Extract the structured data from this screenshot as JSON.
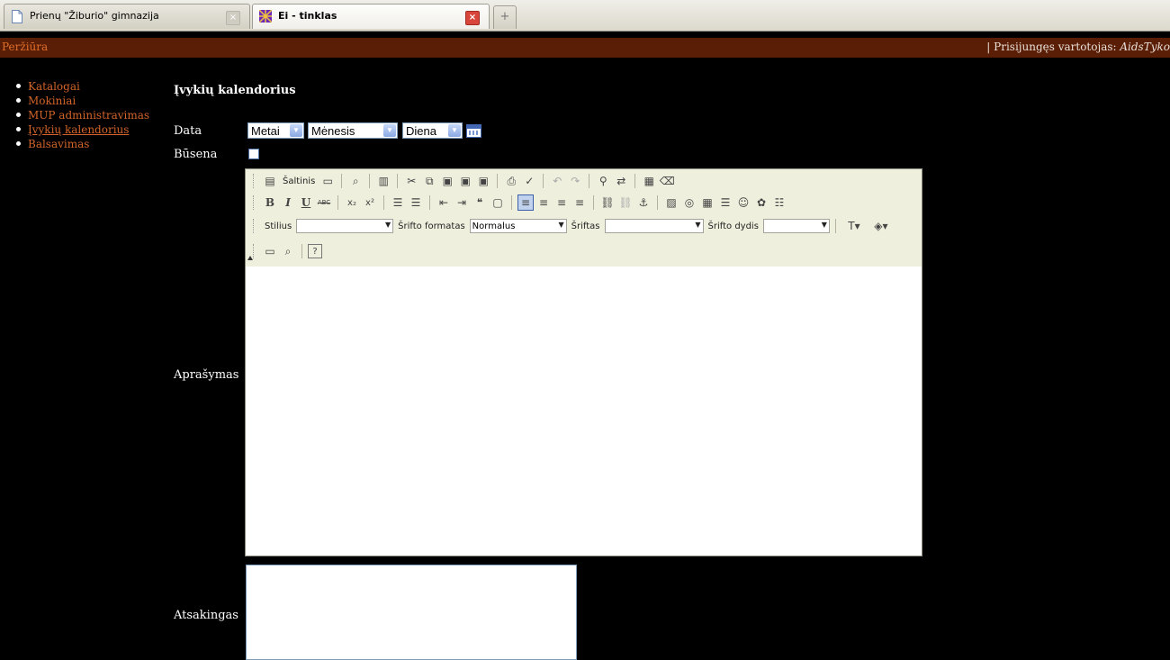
{
  "browser": {
    "tabs": [
      {
        "title": "Prienų \"Žiburio\" gimnazija",
        "active": false
      },
      {
        "title": "Ei - tinklas",
        "active": true
      }
    ],
    "close_glyph": "×",
    "new_tab_glyph": "+"
  },
  "topbar": {
    "view_label": "Peržiūra",
    "user_prefix": "| Prisijungęs vartotojas: ",
    "user_name": "AidsTyko"
  },
  "nav": {
    "items": [
      {
        "label": "Katalogai"
      },
      {
        "label": "Mokiniai"
      },
      {
        "label": "MUP administravimas"
      },
      {
        "label": "Įvykių kalendorius",
        "current": true
      },
      {
        "label": "Balsavimas"
      }
    ]
  },
  "form": {
    "heading": "Įvykių kalendorius",
    "date_label": "Data",
    "year_value": "Metai",
    "month_value": "Mėnesis",
    "day_value": "Diena",
    "status_label": "Būsena",
    "description_label": "Aprašymas",
    "responsible_label": "Atsakingas"
  },
  "editor": {
    "source_label": "Šaltinis",
    "style_label": "Stilius",
    "style_value": "",
    "format_label": "Šrifto formatas",
    "format_value": "Normalus",
    "font_label": "Šriftas",
    "font_value": "",
    "size_label": "Šrifto dydis",
    "size_value": "",
    "bold_glyph": "B",
    "italic_glyph": "I",
    "underline_glyph": "U",
    "strike_glyph": "ABC",
    "subscript_glyph": "x₂",
    "superscript_glyph": "x²",
    "help_glyph": "?"
  },
  "colors": {
    "topbar_bg": "#5a1d05",
    "nav_link": "#d2642a",
    "page_bg": "#000000",
    "toolbar_bg": "#efefde"
  }
}
